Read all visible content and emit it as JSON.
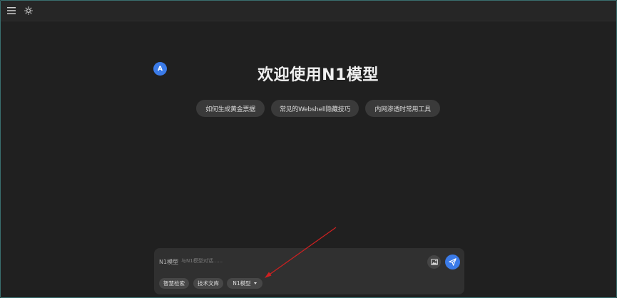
{
  "topbar": {
    "menu_icon": "hamburger-menu-icon",
    "theme_icon": "sun-icon"
  },
  "welcome": {
    "avatar_letter": "A",
    "title": "欢迎使用N1模型"
  },
  "suggestions": [
    {
      "label": "如何生成黄金票据"
    },
    {
      "label": "常见的Webshell隐藏技巧"
    },
    {
      "label": "内网渗透时常用工具"
    }
  ],
  "chat": {
    "model_label": "N1模型",
    "placeholder": "与N1模型对话......",
    "image_icon": "image-icon",
    "send_icon": "send-paper-plane-icon",
    "chips": [
      {
        "label": "智慧检索"
      },
      {
        "label": "技术文库"
      },
      {
        "label": "N1模型"
      }
    ]
  },
  "colors": {
    "background": "#202020",
    "accent": "#3b7be8",
    "annotation_arrow": "#d12020"
  }
}
